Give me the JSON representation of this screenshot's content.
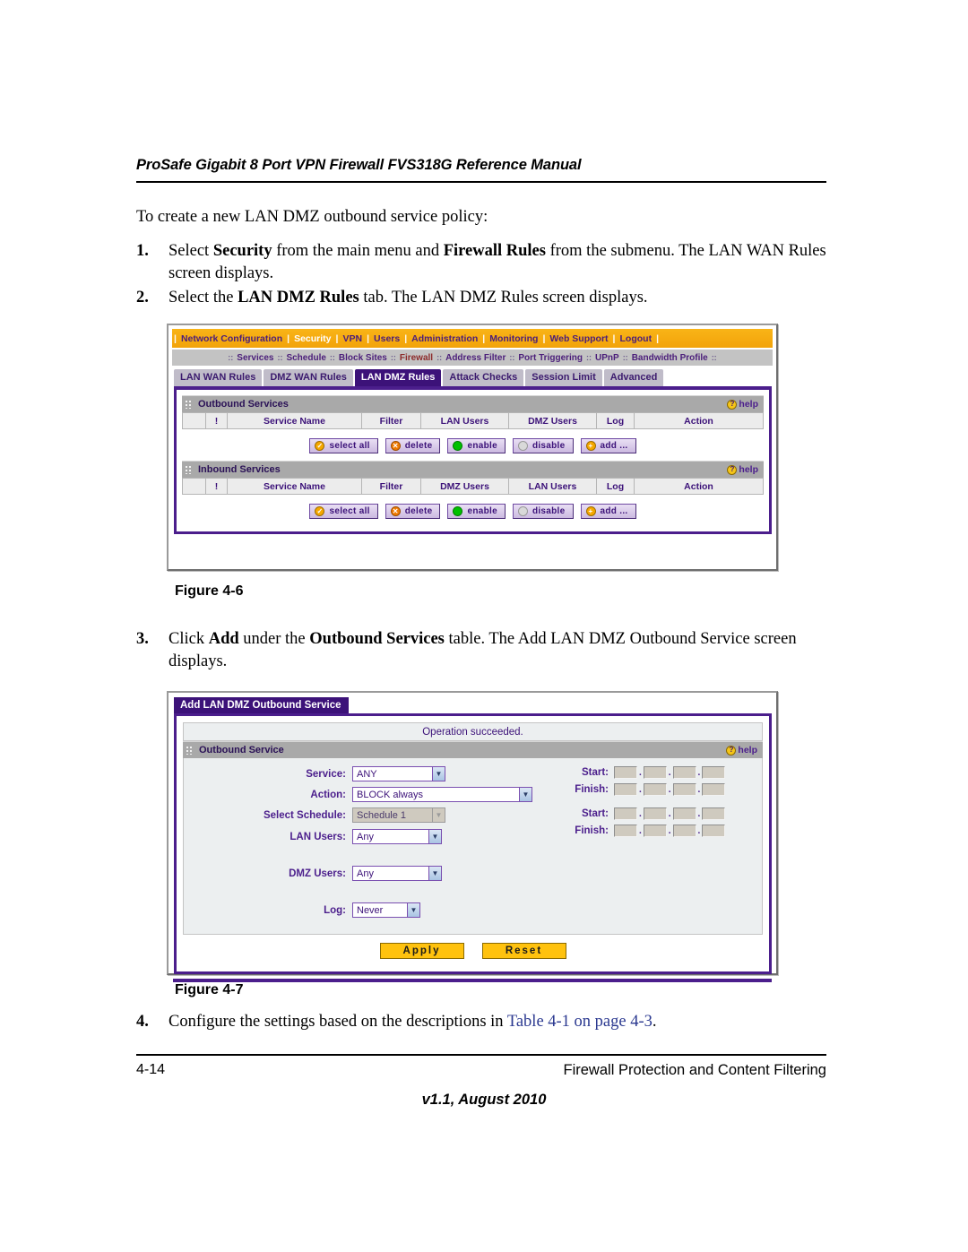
{
  "document": {
    "running_head": "ProSafe Gigabit 8 Port VPN Firewall FVS318G Reference Manual",
    "intro": "To create a new LAN DMZ outbound service policy:",
    "steps": [
      {
        "number": "1.",
        "parts": [
          {
            "t": "Select ",
            "b": false
          },
          {
            "t": "Security",
            "b": true
          },
          {
            "t": " from the main menu and ",
            "b": false
          },
          {
            "t": "Firewall Rules",
            "b": true
          },
          {
            "t": " from the submenu. The LAN WAN Rules screen displays.",
            "b": false
          }
        ]
      },
      {
        "number": "2.",
        "parts": [
          {
            "t": "Select the ",
            "b": false
          },
          {
            "t": "LAN DMZ Rules",
            "b": true
          },
          {
            "t": " tab. The LAN DMZ Rules screen displays.",
            "b": false
          }
        ]
      },
      {
        "number": "3.",
        "parts": [
          {
            "t": "Click ",
            "b": false
          },
          {
            "t": "Add",
            "b": true
          },
          {
            "t": " under the ",
            "b": false
          },
          {
            "t": "Outbound Services",
            "b": true
          },
          {
            "t": " table. The Add LAN DMZ Outbound Service screen displays.",
            "b": false
          }
        ]
      },
      {
        "number": "4.",
        "parts": [
          {
            "t": "Configure the settings based on the descriptions in ",
            "b": false
          },
          {
            "t": "Table 4-1 on page 4-3",
            "b": false,
            "link": true
          },
          {
            "t": ".",
            "b": false
          }
        ]
      }
    ],
    "figure_6_caption": "Figure 4-6",
    "figure_7_caption": "Figure 4-7",
    "footer": {
      "page_number": "4-14",
      "section": "Firewall Protection and Content Filtering",
      "version": "v1.1, August 2010"
    }
  },
  "router_ui": {
    "main_menu": {
      "items": [
        {
          "label": "Network Configuration",
          "active": false
        },
        {
          "label": "Security",
          "active": true
        },
        {
          "label": "VPN",
          "active": false
        },
        {
          "label": "Users",
          "active": false
        },
        {
          "label": "Administration",
          "active": false
        },
        {
          "label": "Monitoring",
          "active": false
        },
        {
          "label": "Web Support",
          "active": false
        },
        {
          "label": "Logout",
          "active": false
        }
      ],
      "separator": "|"
    },
    "sub_menu": {
      "items": [
        {
          "label": "Services",
          "active": false
        },
        {
          "label": "Schedule",
          "active": false
        },
        {
          "label": "Block Sites",
          "active": false
        },
        {
          "label": "Firewall",
          "active": true
        },
        {
          "label": "Address Filter",
          "active": false
        },
        {
          "label": "Port Triggering",
          "active": false
        },
        {
          "label": "UPnP",
          "active": false
        },
        {
          "label": "Bandwidth Profile",
          "active": false
        }
      ],
      "separator": "::"
    },
    "tabs": [
      {
        "label": "LAN WAN Rules",
        "active": false
      },
      {
        "label": "DMZ WAN Rules",
        "active": false
      },
      {
        "label": "LAN DMZ Rules",
        "active": true
      },
      {
        "label": "Attack Checks",
        "active": false
      },
      {
        "label": "Session Limit",
        "active": false
      },
      {
        "label": "Advanced",
        "active": false
      }
    ],
    "help_label": "help",
    "help_icon_glyph": "?",
    "outbound_services": {
      "title": "Outbound Services",
      "columns": [
        "",
        "!",
        "Service Name",
        "Filter",
        "LAN Users",
        "DMZ Users",
        "Log",
        "Action"
      ],
      "rows": [],
      "buttons": [
        {
          "label": "select all",
          "icon": "check-circle-icon",
          "glyph": "✓",
          "color": "#f5a800"
        },
        {
          "label": "delete",
          "icon": "cross-circle-icon",
          "glyph": "✕",
          "color": "#f07a00"
        },
        {
          "label": "enable",
          "icon": "green-circle-icon",
          "glyph": "",
          "color": "#00c000"
        },
        {
          "label": "disable",
          "icon": "gray-circle-icon",
          "glyph": "",
          "color": "#d9d9d9"
        },
        {
          "label": "add ...",
          "icon": "plus-circle-icon",
          "glyph": "+",
          "color": "#f5a800"
        }
      ]
    },
    "inbound_services": {
      "title": "Inbound Services",
      "columns": [
        "",
        "!",
        "Service Name",
        "Filter",
        "DMZ Users",
        "LAN Users",
        "Log",
        "Action"
      ],
      "rows": [],
      "buttons": [
        {
          "label": "select all",
          "icon": "check-circle-icon",
          "glyph": "✓",
          "color": "#f5a800"
        },
        {
          "label": "delete",
          "icon": "cross-circle-icon",
          "glyph": "✕",
          "color": "#f07a00"
        },
        {
          "label": "enable",
          "icon": "green-circle-icon",
          "glyph": "",
          "color": "#00c000"
        },
        {
          "label": "disable",
          "icon": "gray-circle-icon",
          "glyph": "",
          "color": "#d9d9d9"
        },
        {
          "label": "add ...",
          "icon": "plus-circle-icon",
          "glyph": "+",
          "color": "#f5a800"
        }
      ]
    }
  },
  "add_service_screen": {
    "title_tab": "Add LAN DMZ Outbound Service",
    "status_message": "Operation succeeded.",
    "section_title": "Outbound Service",
    "help_label": "help",
    "fields": [
      {
        "label": "Service:",
        "value": "ANY",
        "width": "w-any",
        "disabled": false
      },
      {
        "label": "Action:",
        "value": "BLOCK always",
        "width": "w-act",
        "disabled": false
      },
      {
        "label": "Select Schedule:",
        "value": "Schedule 1",
        "width": "w-sch",
        "disabled": true
      },
      {
        "label": "LAN Users:",
        "value": "Any",
        "width": "w-usr",
        "disabled": false
      },
      {
        "label": "DMZ Users:",
        "value": "Any",
        "width": "w-usr",
        "disabled": false
      },
      {
        "label": "Log:",
        "value": "Never",
        "width": "w-log",
        "disabled": false
      }
    ],
    "ip_ranges": [
      {
        "label": "Start:",
        "octets": [
          "",
          "",
          "",
          ""
        ]
      },
      {
        "label": "Finish:",
        "octets": [
          "",
          "",
          "",
          ""
        ]
      },
      {
        "label": "Start:",
        "octets": [
          "",
          "",
          "",
          ""
        ]
      },
      {
        "label": "Finish:",
        "octets": [
          "",
          "",
          "",
          ""
        ]
      }
    ],
    "buttons": [
      {
        "label": "Apply"
      },
      {
        "label": "Reset"
      }
    ]
  },
  "colors": {
    "menu_orange": "#f2a30a",
    "purple": "#4b1e8c",
    "tab_active": "#3c1279",
    "gold_button": "#ffc20e",
    "link_blue": "#2b3990",
    "section_gray": "#a9a9a9"
  }
}
